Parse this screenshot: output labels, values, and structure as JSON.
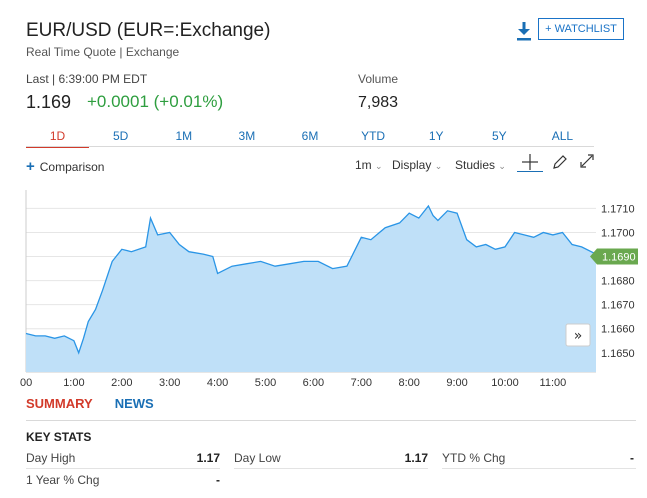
{
  "header": {
    "title": "EUR/USD (EUR=:Exchange)",
    "subtitle": "Real Time Quote | Exchange",
    "watchlist_label": "+ WATCHLIST"
  },
  "quote": {
    "last_label": "Last | 6:39:00 PM EDT",
    "price": "1.169",
    "change": "+0.0001 (+0.01%)",
    "volume_label": "Volume",
    "volume": "7,983"
  },
  "ranges": [
    "1D",
    "5D",
    "1M",
    "3M",
    "6M",
    "YTD",
    "1Y",
    "5Y",
    "ALL"
  ],
  "active_range": "1D",
  "toolbar": {
    "comparison_label": "Comparison",
    "interval_label": "1m",
    "display_label": "Display",
    "studies_label": "Studies"
  },
  "chart_data": {
    "type": "area",
    "x_ticks": [
      "00",
      "1:00",
      "2:00",
      "3:00",
      "4:00",
      "5:00",
      "6:00",
      "7:00",
      "8:00",
      "9:00",
      "10:00",
      "11:00"
    ],
    "y_ticks": [
      "1.1710",
      "1.1700",
      "1.1690",
      "1.1680",
      "1.1670",
      "1.1660",
      "1.1650"
    ],
    "y_tick_values": [
      1.171,
      1.17,
      1.169,
      1.168,
      1.167,
      1.166,
      1.165
    ],
    "ylim": [
      1.1642,
      1.1716
    ],
    "xlim": [
      0,
      11.9
    ],
    "current_value_label": "1.1690",
    "current_value": 1.169,
    "series": [
      {
        "x": [
          0,
          0.2,
          0.4,
          0.6,
          0.8,
          1.0,
          1.1,
          1.2,
          1.3,
          1.45,
          1.6,
          1.8,
          2.0,
          2.2,
          2.5,
          2.6,
          2.75,
          3.0,
          3.2,
          3.4,
          3.7,
          3.9,
          4.0,
          4.3,
          4.6,
          4.9,
          5.2,
          5.5,
          5.8,
          6.1,
          6.4,
          6.7,
          7.0,
          7.2,
          7.5,
          7.8,
          8.0,
          8.2,
          8.4,
          8.5,
          8.6,
          8.8,
          9.0,
          9.2,
          9.4,
          9.6,
          9.8,
          10.0,
          10.2,
          10.4,
          10.6,
          10.8,
          11.0,
          11.2,
          11.4,
          11.6,
          11.9
        ],
        "y": [
          1.1658,
          1.1657,
          1.1657,
          1.1656,
          1.1657,
          1.1655,
          1.165,
          1.1656,
          1.1663,
          1.1668,
          1.1676,
          1.1688,
          1.1693,
          1.1692,
          1.1694,
          1.1706,
          1.1699,
          1.17,
          1.1695,
          1.1692,
          1.1691,
          1.169,
          1.1683,
          1.1686,
          1.1687,
          1.1688,
          1.1686,
          1.1687,
          1.1688,
          1.1688,
          1.1685,
          1.1686,
          1.1698,
          1.1697,
          1.1702,
          1.1704,
          1.1708,
          1.1706,
          1.1711,
          1.1707,
          1.1705,
          1.1709,
          1.1708,
          1.1697,
          1.1694,
          1.1695,
          1.1693,
          1.1694,
          1.17,
          1.1699,
          1.1698,
          1.17,
          1.1699,
          1.17,
          1.1695,
          1.1694,
          1.1691
        ]
      }
    ],
    "grid": "horizontal",
    "fill_color": "#bfe0f8",
    "line_color": "#2a95e6",
    "label_color": "#6aa84f"
  },
  "tabs": {
    "summary": "SUMMARY",
    "news": "NEWS"
  },
  "key_stats": {
    "title": "KEY STATS",
    "day_high_label": "Day High",
    "day_high": "1.17",
    "day_low_label": "Day Low",
    "day_low": "1.17",
    "ytd_label": "YTD % Chg",
    "ytd": "-",
    "year_label": "1 Year % Chg",
    "year": "-"
  },
  "colors": {
    "accent_red": "#d23a2a",
    "link_blue": "#1a6fb5",
    "positive_green": "#2e9e3f"
  }
}
